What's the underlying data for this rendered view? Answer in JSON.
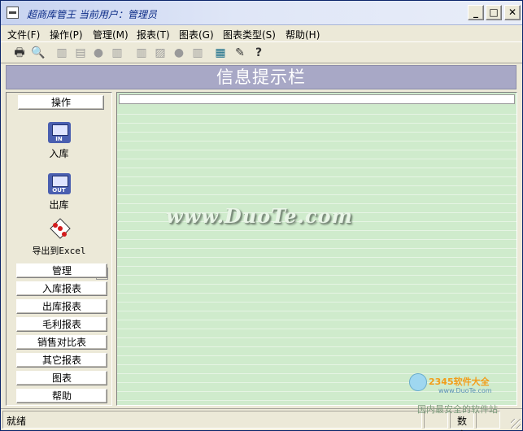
{
  "window": {
    "title": "超商库管王 当前用户：管理员"
  },
  "menu": {
    "items": [
      "文件(F)",
      "操作(P)",
      "管理(M)",
      "报表(T)",
      "图表(G)",
      "图表类型(S)",
      "帮助(H)"
    ]
  },
  "toolbar": {
    "icons": [
      {
        "name": "print-icon",
        "glyph": "🖶"
      },
      {
        "name": "print-preview-icon",
        "glyph": "🔍"
      },
      {
        "name": "bar-chart-icon",
        "glyph": "▥"
      },
      {
        "name": "stacked-chart-icon",
        "glyph": "▤"
      },
      {
        "name": "pie-chart-icon",
        "glyph": "●"
      },
      {
        "name": "column-chart-icon",
        "glyph": "▥"
      },
      {
        "name": "bar-3d-icon",
        "glyph": "▥"
      },
      {
        "name": "area-chart-icon",
        "glyph": "▨"
      },
      {
        "name": "pie-3d-icon",
        "glyph": "●"
      },
      {
        "name": "histogram-icon",
        "glyph": "▥"
      },
      {
        "name": "calculator-icon",
        "glyph": "▦"
      },
      {
        "name": "note-icon",
        "glyph": "✎"
      },
      {
        "name": "help-icon",
        "glyph": "?"
      }
    ]
  },
  "info_header": "信息提示栏",
  "left_panel": {
    "section_top": "操作",
    "ops": [
      {
        "label": "入库",
        "icon": "stock-in-icon",
        "caption": "IN"
      },
      {
        "label": "出库",
        "icon": "stock-out-icon",
        "caption": "OUT"
      },
      {
        "label": "导出到Excel",
        "icon": "export-excel-icon"
      }
    ],
    "sections": [
      "管理",
      "入库报表",
      "出库报表",
      "毛利报表",
      "销售对比表",
      "其它报表",
      "图表",
      "帮助"
    ]
  },
  "content": {
    "watermark": "www.DuoTe.com",
    "corner_logo_text": "2345软件大全",
    "corner_logo_url": "www.DuoTe.com",
    "corner_bottom_text": "国内最安全的软件站"
  },
  "status": {
    "main": "就绪",
    "cell2": "数字"
  }
}
